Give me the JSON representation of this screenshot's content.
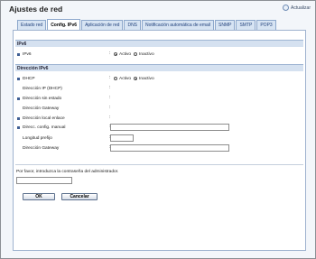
{
  "header": {
    "title": "Ajustes de red",
    "update_label": "Actualizar"
  },
  "tabs": [
    {
      "label": "Estado red",
      "active": false
    },
    {
      "label": "Config. IPv6",
      "active": true
    },
    {
      "label": "Aplicación de red",
      "active": false
    },
    {
      "label": "DNS",
      "active": false
    },
    {
      "label": "Notificación automática de email",
      "active": false
    },
    {
      "label": "SNMP",
      "active": false
    },
    {
      "label": "SMTP",
      "active": false
    },
    {
      "label": "POP3",
      "active": false
    }
  ],
  "ipv6_section": {
    "heading": "IPv6",
    "ipv6": {
      "label": "IPv6",
      "options": [
        "Activo",
        "Inactivo"
      ],
      "selected": "Activo"
    }
  },
  "address_section": {
    "heading": "Dirección IPv6",
    "dhcp": {
      "label": "DHCP",
      "options": [
        "Activo",
        "Inactivo"
      ],
      "selected": "Inactivo"
    },
    "dhcp_address": {
      "label": "Dirección IP (DHCP)"
    },
    "stateless": {
      "label": "Dirección sin estado"
    },
    "stateless_gateway": {
      "label": "Dirección Gateway"
    },
    "link_local": {
      "label": "Dirección local enlace"
    },
    "manual": {
      "label": "Direcc. config. manual",
      "value": ""
    },
    "prefix": {
      "label": "Longitud prefijo",
      "value": ""
    },
    "gateway": {
      "label": "Dirección Gateway",
      "value": ""
    }
  },
  "admin": {
    "prompt": "Por favor, introduzca la contraseña del administrador.",
    "password": ""
  },
  "actions": {
    "ok": "OK",
    "cancel": "Cancelar"
  }
}
